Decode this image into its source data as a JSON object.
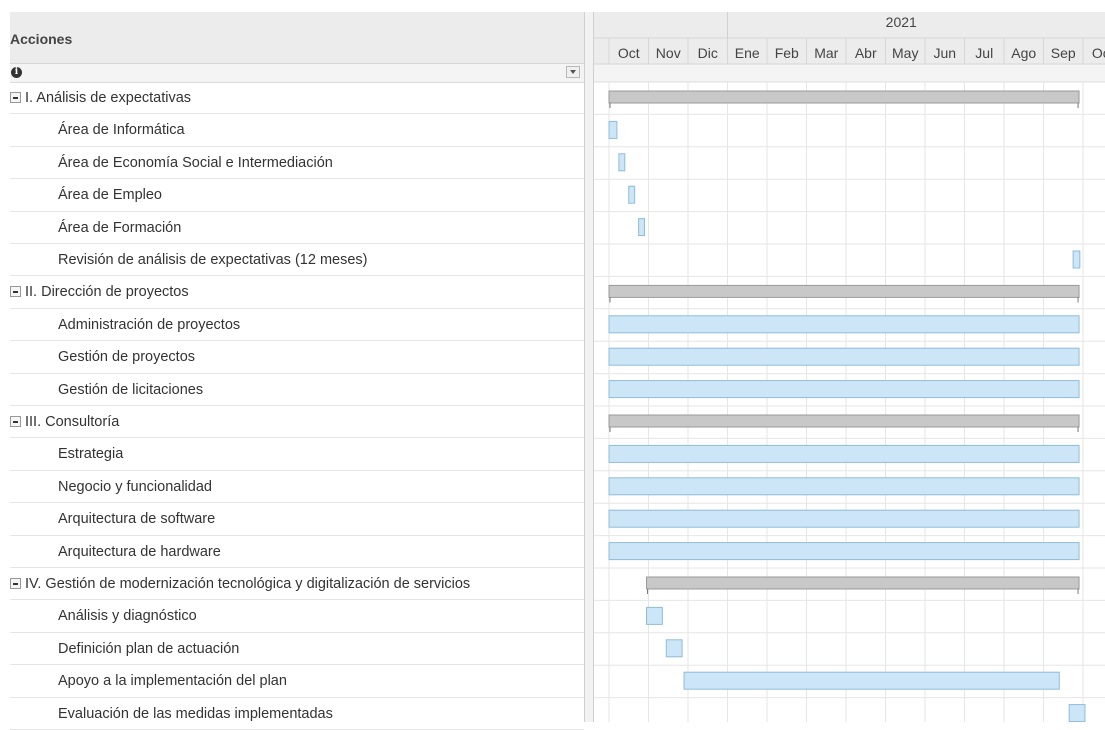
{
  "left_header": {
    "title": "Acciones"
  },
  "timeline": {
    "year": "2021",
    "months": [
      "Oct",
      "Nov",
      "Dic",
      "Ene",
      "Feb",
      "Mar",
      "Abr",
      "May",
      "Jun",
      "Jul",
      "Ago",
      "Sep",
      "Oct"
    ]
  },
  "rows": [
    {
      "label": "I. Análisis de expectativas",
      "group": true,
      "bar": {
        "start": 0.0,
        "end": 11.9
      }
    },
    {
      "label": "Área de Informática",
      "group": false,
      "bar": {
        "start": 0.0,
        "end": 0.2
      }
    },
    {
      "label": "Área de Economía Social e Intermediación",
      "group": false,
      "bar": {
        "start": 0.25,
        "end": 0.4
      }
    },
    {
      "label": "Área de Empleo",
      "group": false,
      "bar": {
        "start": 0.5,
        "end": 0.65
      }
    },
    {
      "label": "Área de Formación",
      "group": false,
      "bar": {
        "start": 0.75,
        "end": 0.9
      }
    },
    {
      "label": "Revisión de análisis de expectativas (12 meses)",
      "group": false,
      "bar": {
        "start": 11.75,
        "end": 11.92
      }
    },
    {
      "label": "II. Dirección de proyectos",
      "group": true,
      "bar": {
        "start": 0.0,
        "end": 11.9
      }
    },
    {
      "label": "Administración de proyectos",
      "group": false,
      "bar": {
        "start": 0.0,
        "end": 11.9
      }
    },
    {
      "label": "Gestión de proyectos",
      "group": false,
      "bar": {
        "start": 0.0,
        "end": 11.9
      }
    },
    {
      "label": "Gestión de licitaciones",
      "group": false,
      "bar": {
        "start": 0.0,
        "end": 11.9
      }
    },
    {
      "label": "III. Consultoría",
      "group": true,
      "bar": {
        "start": 0.0,
        "end": 11.9
      }
    },
    {
      "label": "Estrategia",
      "group": false,
      "bar": {
        "start": 0.0,
        "end": 11.9
      }
    },
    {
      "label": "Negocio y funcionalidad",
      "group": false,
      "bar": {
        "start": 0.0,
        "end": 11.9
      }
    },
    {
      "label": "Arquitectura de software",
      "group": false,
      "bar": {
        "start": 0.0,
        "end": 11.9
      }
    },
    {
      "label": "Arquitectura de hardware",
      "group": false,
      "bar": {
        "start": 0.0,
        "end": 11.9
      }
    },
    {
      "label": "IV. Gestión de modernización tecnológica y digitalización de servicios",
      "group": true,
      "bar": {
        "start": 0.95,
        "end": 11.9
      }
    },
    {
      "label": "Análisis y diagnóstico",
      "group": false,
      "bar": {
        "start": 0.95,
        "end": 1.35
      }
    },
    {
      "label": "Definición plan de actuación",
      "group": false,
      "bar": {
        "start": 1.45,
        "end": 1.85
      }
    },
    {
      "label": "Apoyo a la implementación del plan",
      "group": false,
      "bar": {
        "start": 1.9,
        "end": 11.4
      }
    },
    {
      "label": "Evaluación de las medidas implementadas",
      "group": false,
      "bar": {
        "start": 11.65,
        "end": 12.05
      }
    }
  ],
  "colors": {
    "group_bar": "#c8c8c8",
    "group_bar_border": "#9a9a9a",
    "task_bar": "#cce6f7",
    "task_bar_border": "#8fbcd8",
    "grid": "#e6e6e6"
  }
}
